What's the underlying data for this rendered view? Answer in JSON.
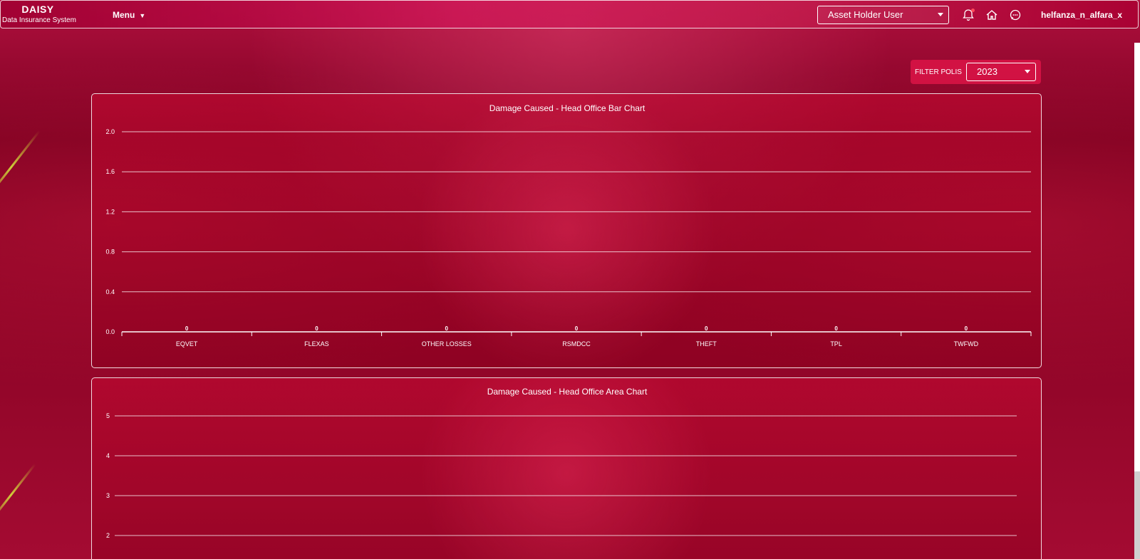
{
  "navbar": {
    "brand_title": "DAISY",
    "brand_subtitle": "Data Insurance System",
    "menu_label": "Menu",
    "role_selected": "Asset Holder User",
    "username": "helfanza_n_alfara_x",
    "icons": [
      "bell-icon",
      "home-icon",
      "chat-icon"
    ]
  },
  "filter": {
    "label": "FILTER POLIS",
    "year_selected": "2023"
  },
  "chart_data": [
    {
      "type": "bar",
      "title": "Damage Caused - Head Office Bar Chart",
      "categories": [
        "EQVET",
        "FLEXAS",
        "OTHER LOSSES",
        "RSMDCC",
        "THEFT",
        "TPL",
        "TWFWD"
      ],
      "values": [
        0,
        0,
        0,
        0,
        0,
        0,
        0
      ],
      "ylim": [
        0,
        2.0
      ],
      "yticks": [
        "0.0",
        "0.4",
        "0.8",
        "1.2",
        "1.6",
        "2.0"
      ],
      "grid": true
    },
    {
      "type": "area",
      "title": "Damage Caused - Head Office Area Chart",
      "yticks_visible": [
        "2",
        "3",
        "4",
        "5"
      ],
      "grid": true
    }
  ],
  "colors": {
    "accent": "#e0144a",
    "panel_border": "#ffffff",
    "background": "#8c0426"
  }
}
